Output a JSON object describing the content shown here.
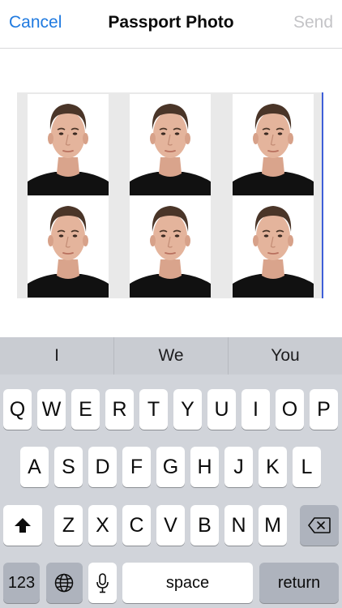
{
  "nav": {
    "cancel_label": "Cancel",
    "title": "Passport Photo",
    "send_label": "Send"
  },
  "photos": {
    "count": 6,
    "background_color": "#e9e9e9",
    "cursor_color": "#3e5fd8"
  },
  "suggestions": [
    "I",
    "We",
    "You"
  ],
  "keyboard": {
    "row1": [
      "Q",
      "W",
      "E",
      "R",
      "T",
      "Y",
      "U",
      "I",
      "O",
      "P"
    ],
    "row2": [
      "A",
      "S",
      "D",
      "F",
      "G",
      "H",
      "J",
      "K",
      "L"
    ],
    "row3": [
      "Z",
      "X",
      "C",
      "V",
      "B",
      "N",
      "M"
    ],
    "numbers_label": "123",
    "space_label": "space",
    "return_label": "return",
    "shift_icon": "shift-icon",
    "delete_icon": "delete-icon",
    "globe_icon": "globe-icon",
    "mic_icon": "microphone-icon"
  },
  "colors": {
    "accent": "#1f7ae0",
    "send_disabled": "#c4c4c7",
    "keyboard_bg": "#d1d4da"
  }
}
